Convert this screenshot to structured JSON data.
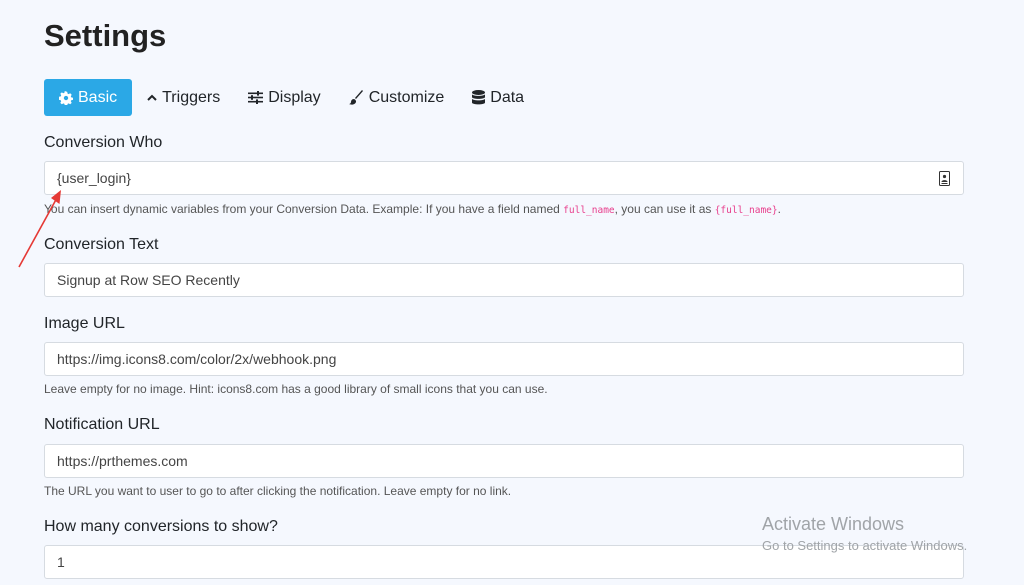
{
  "page": {
    "title": "Settings"
  },
  "tabs": [
    {
      "label": "Basic",
      "icon": "gear-icon",
      "active": true
    },
    {
      "label": "Triggers",
      "icon": "chevron-up-icon",
      "active": false
    },
    {
      "label": "Display",
      "icon": "sliders-icon",
      "active": false
    },
    {
      "label": "Customize",
      "icon": "brush-icon",
      "active": false
    },
    {
      "label": "Data",
      "icon": "database-icon",
      "active": false
    }
  ],
  "fields": {
    "conversion_who": {
      "label": "Conversion Who",
      "value": "{user_login}",
      "trailing_icon": "contact-card-icon",
      "help_pre": "You can insert dynamic variables from your Conversion Data. Example: If you have a field named ",
      "help_code1": "full_name",
      "help_mid": ", you can use it as ",
      "help_code2": "{full_name}",
      "help_post": "."
    },
    "conversion_text": {
      "label": "Conversion Text",
      "value": "Signup at Row SEO Recently"
    },
    "image_url": {
      "label": "Image URL",
      "value": "https://img.icons8.com/color/2x/webhook.png",
      "help": "Leave empty for no image. Hint: icons8.com has a good library of small icons that you can use."
    },
    "notification_url": {
      "label": "Notification URL",
      "value": "https://prthemes.com",
      "help": "The URL you want to user to go to after clicking the notification. Leave empty for no link."
    },
    "conversions_count": {
      "label": "How many conversions to show?",
      "value": "1"
    }
  },
  "watermark": {
    "title": "Activate Windows",
    "subtitle": "Go to Settings to activate Windows."
  },
  "colors": {
    "accent": "#2ba8e6",
    "background": "#f5f8fe",
    "arrow": "#e53935",
    "code": "#e83e8c"
  }
}
